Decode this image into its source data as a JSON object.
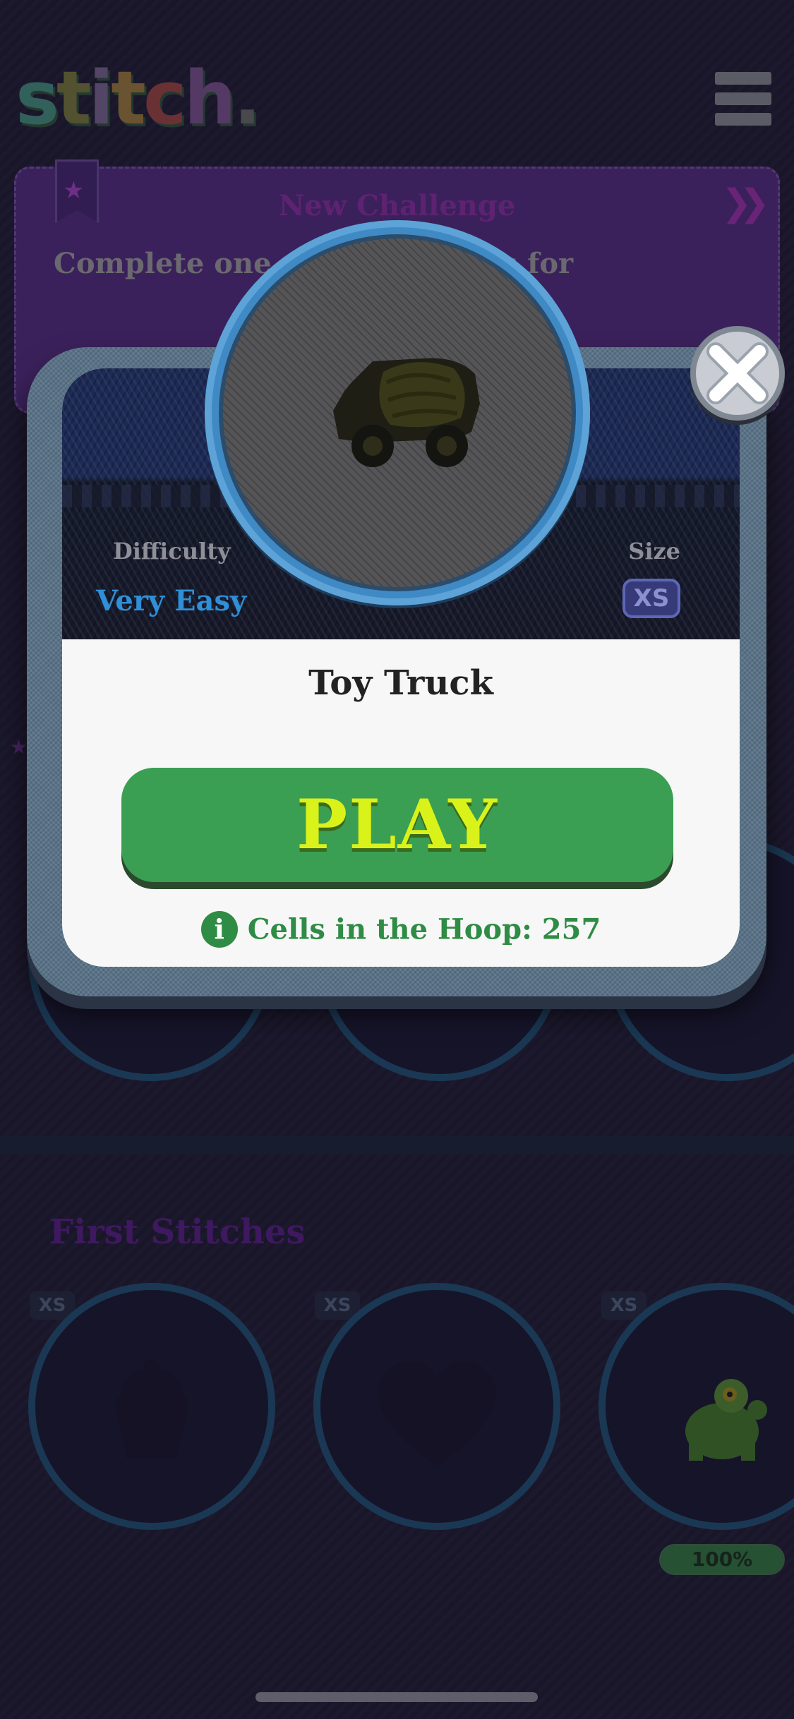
{
  "app": {
    "logo_text": "stitch."
  },
  "challenge": {
    "title": "New Challenge",
    "description": "Complete one of the Patterns for"
  },
  "sections": {
    "first_stitches_title": "First Stitches",
    "first_stitches_items": [
      {
        "size": "XS",
        "shape": "cupcake"
      },
      {
        "size": "XS",
        "shape": "heart"
      },
      {
        "size": "XS",
        "shape": "turtle",
        "progress_label": "100%",
        "progress": 1.0
      }
    ]
  },
  "modal": {
    "difficulty_label": "Difficulty",
    "difficulty_value": "Very Easy",
    "size_label": "Size",
    "size_value": "XS",
    "pattern_name": "Toy Truck",
    "play_label": "PLAY",
    "cells_text": "Cells in the Hoop: 257",
    "info_icon_glyph": "i",
    "close_icon": "close-icon"
  },
  "colors": {
    "play_bg": "#3a9f52",
    "play_text": "#d9f21a",
    "difficulty": "#2f8fd8",
    "cells_text": "#2f8c44"
  }
}
